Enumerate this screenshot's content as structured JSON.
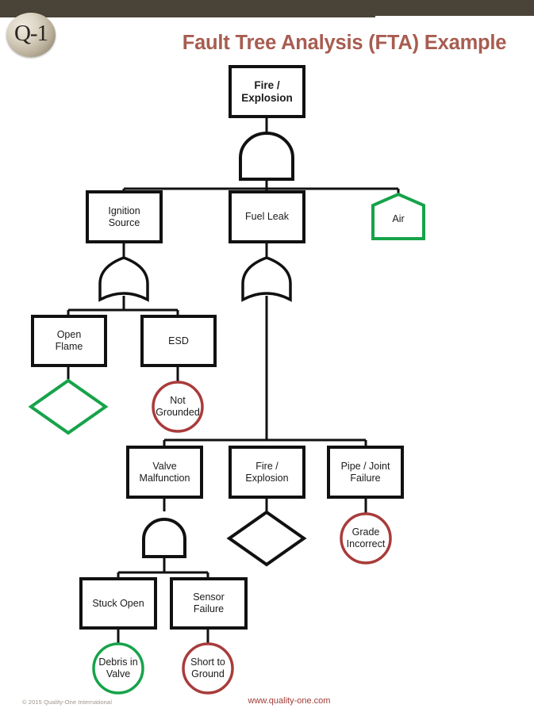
{
  "header": {
    "logo_text": "Q-1",
    "title": "Fault Tree Analysis (FTA) Example"
  },
  "footer": {
    "copyright": "© 2015 Quality-One International",
    "website": "www.quality-one.com"
  },
  "colors": {
    "topbar": "#4a4338",
    "title": "#a85c50",
    "node_stroke": "#111111",
    "green": "#16a34a",
    "red": "#a93b3b",
    "url": "#9f3b36",
    "copyright": "#9b958c"
  },
  "diagram": {
    "type": "fault-tree",
    "nodes": [
      {
        "id": "top_event",
        "label": "Fire /\nExplosion",
        "shape": "rect",
        "color": "black",
        "level": 0
      },
      {
        "id": "ignition_source",
        "label": "Ignition\nSource",
        "shape": "rect",
        "color": "black",
        "level": 1
      },
      {
        "id": "fuel_leak",
        "label": "Fuel Leak",
        "shape": "rect",
        "color": "black",
        "level": 1
      },
      {
        "id": "air",
        "label": "Air",
        "shape": "house",
        "color": "green",
        "level": 1
      },
      {
        "id": "open_flame",
        "label": "Open\nFlame",
        "shape": "rect",
        "color": "black",
        "level": 2
      },
      {
        "id": "esd",
        "label": "ESD",
        "shape": "rect",
        "color": "black",
        "level": 2
      },
      {
        "id": "open_flame_undev",
        "label": "",
        "shape": "diamond",
        "color": "green",
        "level": 3
      },
      {
        "id": "not_grounded",
        "label": "Not\nGrounded",
        "shape": "circle",
        "color": "red",
        "level": 3
      },
      {
        "id": "valve_malfunction",
        "label": "Valve\nMalfunction",
        "shape": "rect",
        "color": "black",
        "level": 3
      },
      {
        "id": "fire_explosion_2",
        "label": "Fire /\nExplosion",
        "shape": "rect",
        "color": "black",
        "level": 3
      },
      {
        "id": "pipe_joint_fail",
        "label": "Pipe / Joint\nFailure",
        "shape": "rect",
        "color": "black",
        "level": 3
      },
      {
        "id": "fire_explosion_transfer",
        "label": "",
        "shape": "diamond",
        "color": "black",
        "level": 4
      },
      {
        "id": "grade_incorrect",
        "label": "Grade\nIncorrect",
        "shape": "circle",
        "color": "red",
        "level": 4
      },
      {
        "id": "stuck_open",
        "label": "Stuck Open",
        "shape": "rect",
        "color": "black",
        "level": 4
      },
      {
        "id": "sensor_failure",
        "label": "Sensor\nFailure",
        "shape": "rect",
        "color": "black",
        "level": 4
      },
      {
        "id": "debris_in_valve",
        "label": "Debris in\nValve",
        "shape": "circle",
        "color": "green",
        "level": 5
      },
      {
        "id": "short_to_ground",
        "label": "Short  to\nGround",
        "shape": "circle",
        "color": "red",
        "level": 5
      }
    ],
    "gates": [
      {
        "id": "gate_top",
        "type": "AND",
        "output": "top_event",
        "inputs": [
          "ignition_source",
          "fuel_leak",
          "air"
        ]
      },
      {
        "id": "gate_ign",
        "type": "OR",
        "output": "ignition_source",
        "inputs": [
          "open_flame",
          "esd"
        ]
      },
      {
        "id": "gate_fuel",
        "type": "OR",
        "output": "fuel_leak",
        "inputs": [
          "valve_malfunction",
          "fire_explosion_2",
          "pipe_joint_fail"
        ]
      },
      {
        "id": "gate_valve",
        "type": "AND",
        "output": "valve_malfunction",
        "inputs": [
          "stuck_open",
          "sensor_failure"
        ]
      }
    ]
  },
  "labels": {
    "top_event": "Fire /\nExplosion",
    "ignition_source": "Ignition\nSource",
    "fuel_leak": "Fuel Leak",
    "air": "Air",
    "open_flame": "Open\nFlame",
    "esd": "ESD",
    "not_grounded": "Not\nGrounded",
    "valve_malfunction": "Valve\nMalfunction",
    "fire_explosion_2": "Fire /\nExplosion",
    "pipe_joint_fail": "Pipe / Joint\nFailure",
    "grade_incorrect": "Grade\nIncorrect",
    "stuck_open": "Stuck Open",
    "sensor_failure": "Sensor\nFailure",
    "debris_in_valve": "Debris in\nValve",
    "short_to_ground": "Short  to\nGround"
  }
}
